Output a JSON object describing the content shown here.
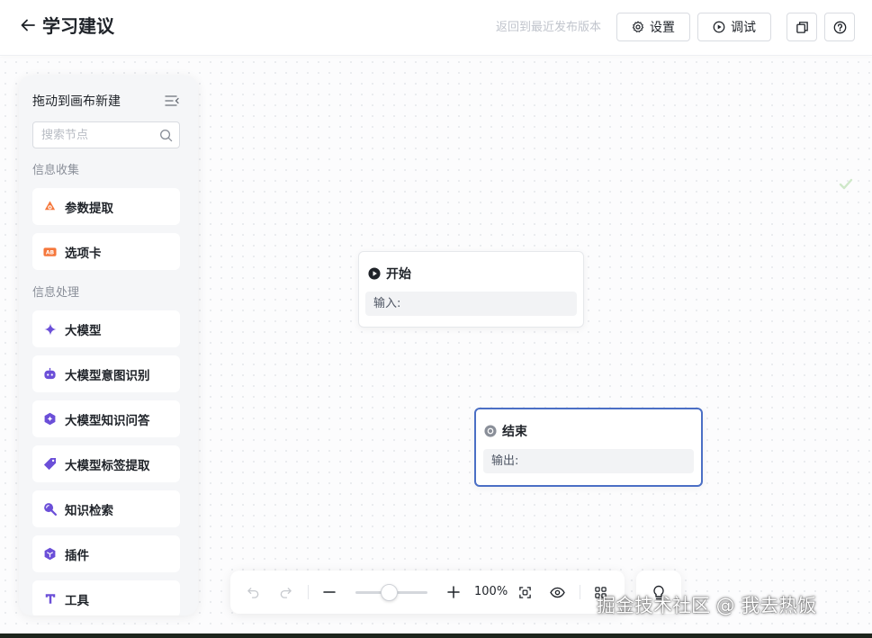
{
  "header": {
    "title": "学习建议",
    "revert_link": "返回到最近发布版本",
    "settings_label": "设置",
    "debug_label": "调试"
  },
  "panel": {
    "title": "拖动到画布新建",
    "search_placeholder": "搜索节点",
    "categories": [
      {
        "label": "信息收集",
        "items": [
          {
            "label": "参数提取",
            "icon": "param-extract-icon",
            "color": "#f5773b"
          },
          {
            "label": "选项卡",
            "icon": "ab-tab-icon",
            "color": "#f5773b"
          }
        ]
      },
      {
        "label": "信息处理",
        "items": [
          {
            "label": "大模型",
            "icon": "sparkle-icon",
            "color": "#6b4fd8"
          },
          {
            "label": "大模型意图识别",
            "icon": "robot-icon",
            "color": "#6b4fd8"
          },
          {
            "label": "大模型知识问答",
            "icon": "knowledge-qa-icon",
            "color": "#6b4fd8"
          },
          {
            "label": "大模型标签提取",
            "icon": "tag-icon",
            "color": "#6b4fd8"
          },
          {
            "label": "知识检索",
            "icon": "search-knowledge-icon",
            "color": "#6b4fd8"
          },
          {
            "label": "插件",
            "icon": "plugin-icon",
            "color": "#6b4fd8"
          },
          {
            "label": "工具",
            "icon": "tool-icon",
            "color": "#6b4fd8"
          }
        ]
      }
    ]
  },
  "nodes": {
    "start": {
      "title": "开始",
      "field": "输入:"
    },
    "end": {
      "title": "结束",
      "field": "输出:"
    }
  },
  "toolbar": {
    "zoom": "100%",
    "zoom_level": 1.0
  },
  "watermark": "掘金技术社区 @ 我去热饭",
  "colors": {
    "accent": "#4b6fc5",
    "orange": "#f5773b",
    "purple": "#6b4fd8"
  }
}
